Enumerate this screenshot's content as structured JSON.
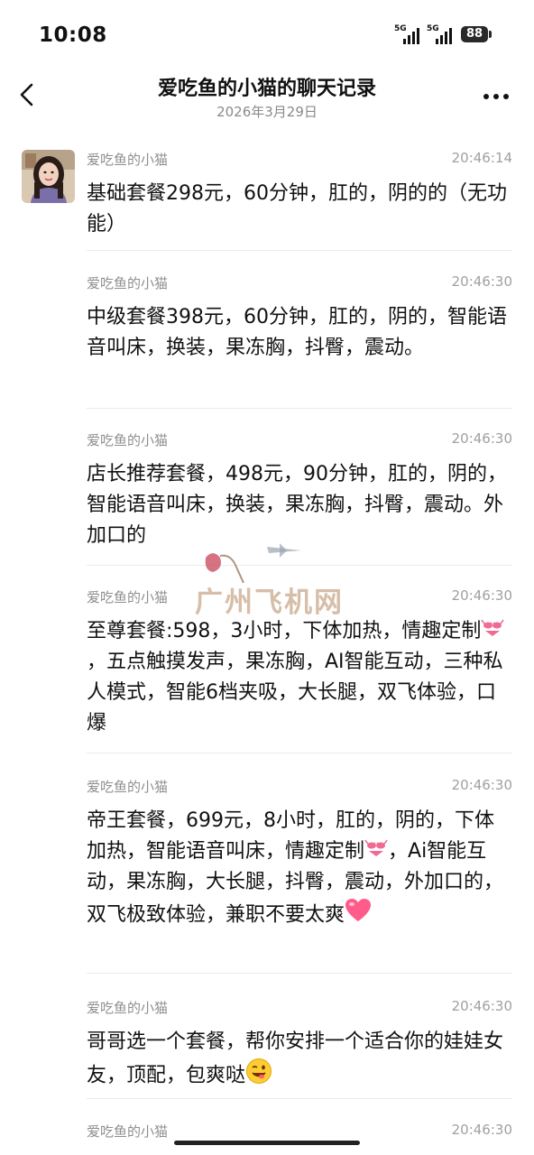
{
  "status_bar": {
    "time": "10:08",
    "signal1": "5G",
    "signal2": "5G",
    "battery": "88"
  },
  "header": {
    "title": "爱吃鱼的小猫的聊天记录",
    "date": "2026年3月29日"
  },
  "messages": [
    {
      "sender": "爱吃鱼的小猫",
      "time": "20:46:14",
      "text": "基础套餐298元，60分钟，肛的，阴的的（无功能）"
    },
    {
      "sender": "爱吃鱼的小猫",
      "time": "20:46:30",
      "text": "中级套餐398元，60分钟，肛的，阴的，智能语音叫床，换装，果冻胸，抖臀，震动。"
    },
    {
      "sender": "爱吃鱼的小猫",
      "time": "20:46:30",
      "text": "店长推荐套餐，498元，90分钟，肛的，阴的，智能语音叫床，换装，果冻胸，抖臀，震动。外加口的"
    },
    {
      "sender": "爱吃鱼的小猫",
      "time": "20:46:30",
      "text_a": "至尊套餐:598，3小时，下体加热，情趣定制",
      "text_b": "，五点触摸发声，果冻胸，AI智能互动，三种私人模式，智能6档夹吸，大长腿，双飞体验，口爆"
    },
    {
      "sender": "爱吃鱼的小猫",
      "time": "20:46:30",
      "text_a": "帝王套餐，699元，8小时，肛的，阴的，下体加热，智能语音叫床，情趣定制",
      "text_b": "，Ai智能互动，果冻胸，大长腿，抖臀，震动，外加口的，双飞极致体验，兼职不要太爽"
    },
    {
      "sender": "爱吃鱼的小猫",
      "time": "20:46:30",
      "text": "哥哥选一个套餐，帮你安排一个适合你的娃娃女友，顶配，包爽哒"
    },
    {
      "sender": "爱吃鱼的小猫",
      "time": "20:46:30"
    }
  ],
  "watermark": {
    "text": "广州飞机网"
  },
  "icons": [
    "back-arrow-icon",
    "more-icon",
    "bikini-emoji",
    "heart-emoji",
    "wink-emoji"
  ]
}
